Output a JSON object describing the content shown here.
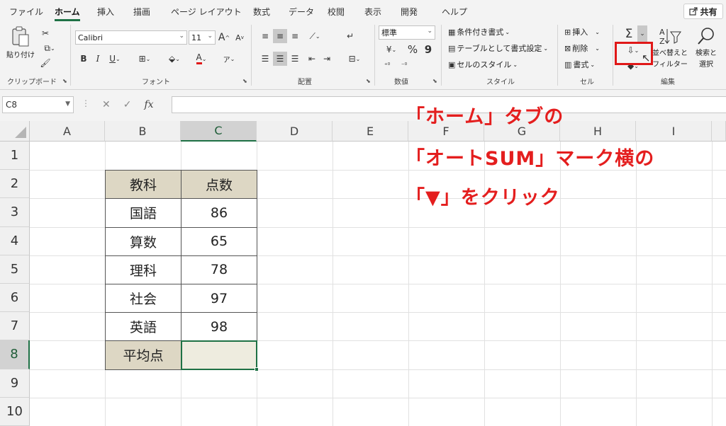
{
  "tabs": [
    "ファイル",
    "ホーム",
    "挿入",
    "描画",
    "ページ レイアウト",
    "数式",
    "データ",
    "校閲",
    "表示",
    "開発",
    "ヘルプ"
  ],
  "active_tab": "ホーム",
  "share_label": "共有",
  "ribbon": {
    "clipboard": {
      "paste_label": "貼り付け",
      "group_label": "クリップボード"
    },
    "font": {
      "font_name": "Calibri",
      "font_size": "11",
      "group_label": "フォント",
      "bold": "B",
      "italic": "I",
      "underline": "U",
      "grow": "A",
      "shrink": "A",
      "font_color_glyph": "A",
      "phonetic_glyph": "ア"
    },
    "alignment": {
      "group_label": "配置"
    },
    "number": {
      "format": "標準",
      "percent": "%",
      "comma": "9",
      "group_label": "数値"
    },
    "styles": {
      "conditional": "条件付き書式",
      "as_table": "テーブルとして書式設定",
      "cell_styles": "セルのスタイル",
      "group_label": "スタイル"
    },
    "cells": {
      "insert": "挿入",
      "delete": "削除",
      "format": "書式",
      "group_label": "セル"
    },
    "editing": {
      "autosum_glyph": "Σ",
      "sort_filter_line1": "並べ替えと",
      "sort_filter_line2": "フィルター",
      "find_select_line1": "検索と",
      "find_select_line2": "選択",
      "group_label": "編集"
    }
  },
  "formula_bar": {
    "name_box": "C8",
    "fx": "fx",
    "cancel": "✕",
    "enter": "✓",
    "formula": ""
  },
  "columns": [
    "A",
    "B",
    "C",
    "D",
    "E",
    "F",
    "G",
    "H",
    "I"
  ],
  "rows": [
    "1",
    "2",
    "3",
    "4",
    "5",
    "6",
    "7",
    "8",
    "9",
    "10"
  ],
  "table": {
    "header": [
      "教科",
      "点数"
    ],
    "rows": [
      [
        "国語",
        "86"
      ],
      [
        "算数",
        "65"
      ],
      [
        "理科",
        "78"
      ],
      [
        "社会",
        "97"
      ],
      [
        "英語",
        "98"
      ]
    ],
    "footer_label": "平均点",
    "footer_value": ""
  },
  "annotation": {
    "line1": "「ホーム」タブの",
    "line2": "「オートSUM」マーク横の",
    "line3": "「▼」をクリック"
  },
  "colors": {
    "accent": "#1e7145",
    "annotation": "#e41e1e",
    "header_fill": "#ddd7c4"
  }
}
